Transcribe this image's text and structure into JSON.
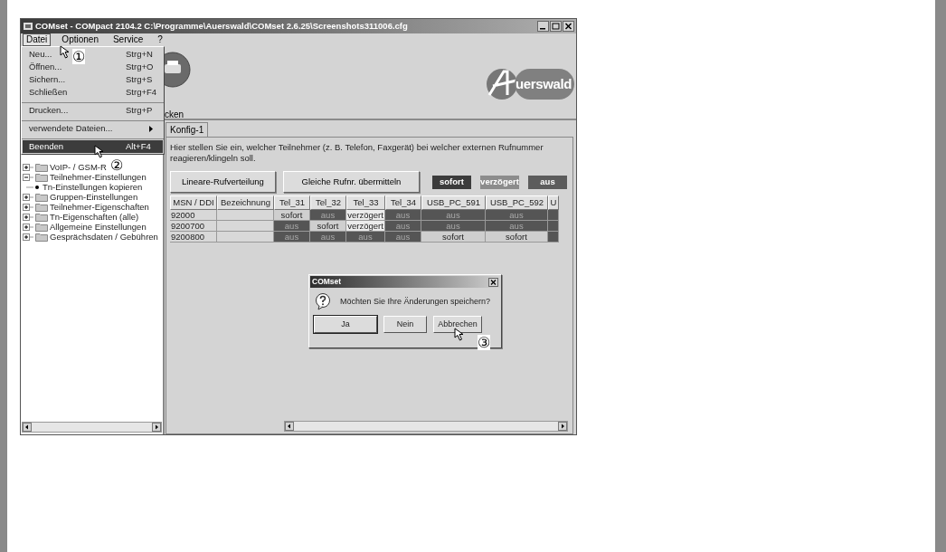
{
  "window": {
    "title": "COMset - COMpact 2104.2  C:\\Programme\\Auerswald\\COMset 2.6.25\\Screenshots311006.cfg"
  },
  "menu_bar": [
    {
      "label": "Datei",
      "selected": true
    },
    {
      "label": "Optionen",
      "selected": false
    },
    {
      "label": "Service",
      "selected": false
    },
    {
      "label": "?",
      "selected": false
    }
  ],
  "file_menu": [
    {
      "kind": "item",
      "label": "Neu...",
      "shortcut": "Strg+N",
      "selected": false
    },
    {
      "kind": "item",
      "label": "Öffnen...",
      "shortcut": "Strg+O",
      "selected": false
    },
    {
      "kind": "item",
      "label": "Sichern...",
      "shortcut": "Strg+S",
      "selected": false
    },
    {
      "kind": "item",
      "label": "Schließen",
      "shortcut": "Strg+F4",
      "selected": false
    },
    {
      "kind": "separator"
    },
    {
      "kind": "item",
      "label": "Drucken...",
      "shortcut": "Strg+P",
      "selected": false
    },
    {
      "kind": "separator"
    },
    {
      "kind": "submenu",
      "label": "verwendete Dateien...",
      "selected": false
    },
    {
      "kind": "separator"
    },
    {
      "kind": "item",
      "label": "Beenden",
      "shortcut": "Alt+F4",
      "selected": true
    }
  ],
  "toolbar": {
    "label": "cken"
  },
  "logo": {
    "text": "uerswald"
  },
  "tree": [
    {
      "label": "VoIP- / GSM-R",
      "kind": "folder",
      "expanded": false
    },
    {
      "label": "Teilnehmer-Einstellungen",
      "kind": "folder",
      "expanded": true,
      "children": [
        {
          "label": "Tn-Einstellungen kopieren",
          "kind": "leaf"
        }
      ]
    },
    {
      "label": "Gruppen-Einstellungen",
      "kind": "folder",
      "expanded": false
    },
    {
      "label": "Teilnehmer-Eigenschaften",
      "kind": "folder",
      "expanded": false
    },
    {
      "label": "Tn-Eigenschaften (alle)",
      "kind": "folder",
      "expanded": false
    },
    {
      "label": "Allgemeine Einstellungen",
      "kind": "folder",
      "expanded": false
    },
    {
      "label": "Gesprächsdaten / Gebühren",
      "kind": "folder",
      "expanded": false
    }
  ],
  "tabs": [
    {
      "label": "Konfig-1",
      "selected": true
    }
  ],
  "description": "Hier stellen Sie ein, welcher Teilnehmer (z. B. Telefon, Faxgerät) bei welcher externen Rufnummer reagieren/klingeln soll.",
  "buttons": [
    "Lineare-Rufverteilung",
    "Gleiche Rufnr. übermitteln"
  ],
  "legend": [
    {
      "label": "sofort",
      "color": "#3c3c3c"
    },
    {
      "label": "verzögert",
      "color": "#8c8c8c"
    },
    {
      "label": "aus",
      "color": "#5c5c5c"
    }
  ],
  "table": {
    "columns": [
      "MSN / DDI",
      "Bezeichnung",
      "Tel_31",
      "Tel_32",
      "Tel_33",
      "Tel_34",
      "USB_PC_591",
      "USB_PC_592",
      "U"
    ],
    "rows": [
      {
        "cells": [
          {
            "kind": "plain",
            "text": "92000"
          },
          {
            "kind": "plain"
          },
          {
            "kind": "sofort",
            "text": "sofort"
          },
          {
            "kind": "aus",
            "text": "aus"
          },
          {
            "kind": "verzoegert",
            "text": "verzögert"
          },
          {
            "kind": "aus",
            "text": "aus"
          },
          {
            "kind": "aus",
            "text": "aus"
          },
          {
            "kind": "aus",
            "text": "aus"
          },
          {
            "kind": "aus"
          }
        ]
      },
      {
        "cells": [
          {
            "kind": "plain",
            "text": "9200700"
          },
          {
            "kind": "plain"
          },
          {
            "kind": "aus",
            "text": "aus"
          },
          {
            "kind": "sofort",
            "text": "sofort"
          },
          {
            "kind": "verzoegert",
            "text": "verzögert"
          },
          {
            "kind": "aus",
            "text": "aus"
          },
          {
            "kind": "aus",
            "text": "aus"
          },
          {
            "kind": "aus",
            "text": "aus"
          },
          {
            "kind": "aus"
          }
        ]
      },
      {
        "cells": [
          {
            "kind": "plain",
            "text": "9200800"
          },
          {
            "kind": "plain"
          },
          {
            "kind": "aus",
            "text": "aus"
          },
          {
            "kind": "aus",
            "text": "aus"
          },
          {
            "kind": "aus",
            "text": "aus"
          },
          {
            "kind": "aus",
            "text": "aus"
          },
          {
            "kind": "sofort",
            "text": "sofort"
          },
          {
            "kind": "sofort",
            "text": "sofort"
          },
          {
            "kind": "aus"
          }
        ]
      }
    ]
  },
  "dialog": {
    "title": "COMset",
    "message": "Möchten Sie Ihre Änderungen speichern?",
    "buttons": [
      {
        "label": "Ja",
        "default": true
      },
      {
        "label": "Nein",
        "default": false
      },
      {
        "label": "Abbrechen",
        "default": false
      }
    ]
  },
  "callouts": [
    {
      "label": "①"
    },
    {
      "label": "②"
    },
    {
      "label": "③"
    }
  ]
}
